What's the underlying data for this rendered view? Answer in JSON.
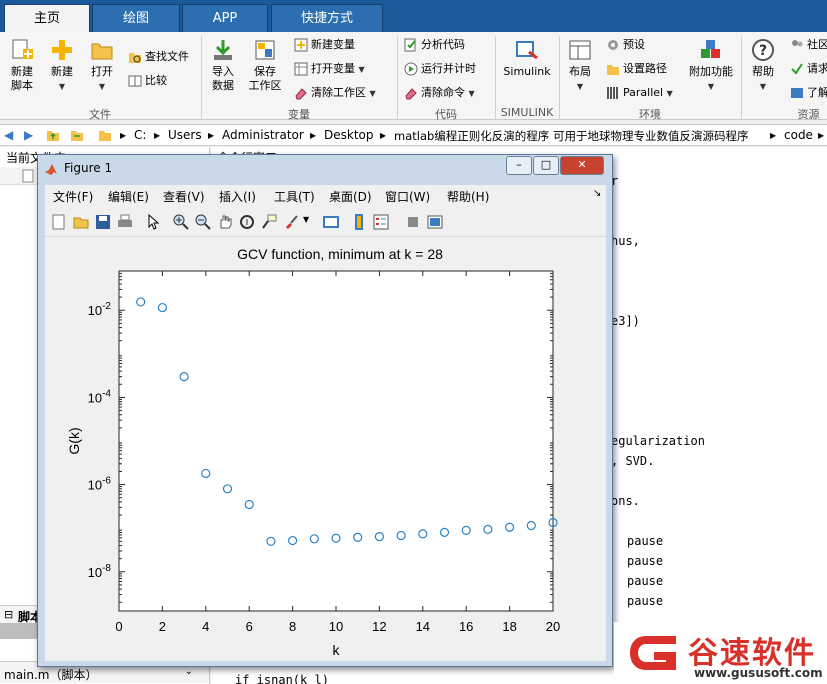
{
  "tabs": [
    "主页",
    "绘图",
    "APP",
    "快捷方式"
  ],
  "ribbon": {
    "file_group": {
      "label": "文件",
      "new_script": "新建\n脚本",
      "new": "新建",
      "open": "打开",
      "find_files": "查找文件",
      "compare": "比较"
    },
    "variable_group": {
      "label": "变量",
      "import_data": "导入\n数据",
      "save_workspace": "保存\n工作区",
      "new_variable": "新建变量",
      "open_variable": "打开变量",
      "clear_workspace": "清除工作区"
    },
    "code_group": {
      "label": "代码",
      "analyze_code": "分析代码",
      "run_and_time": "运行并计时",
      "clear_commands": "清除命令"
    },
    "simulink_group": {
      "label": "SIMULINK",
      "simulink": "Simulink"
    },
    "environment_group": {
      "label": "环境",
      "layout": "布局",
      "preferences": "预设",
      "set_path": "设置路径",
      "parallel": "Parallel",
      "addons": "附加功能"
    },
    "resources_group": {
      "label": "资源",
      "help": "帮助",
      "community": "社区",
      "request_support": "请求",
      "learn": "了解"
    }
  },
  "address": {
    "path": [
      "C:",
      "Users",
      "Administrator",
      "Desktop",
      "matlab编程正则化反演的程序 可用于地球物理专业数值反演源码程序",
      "code"
    ]
  },
  "left_panel": {
    "title": "当前文件夹",
    "details_label": "脚本",
    "bottom_file": "main.m（脚本）"
  },
  "right_panel": {
    "title": "命令行窗口",
    "lines": [
      {
        "text": "r",
        "row": 0
      },
      {
        "text": "hus,",
        "row": 1
      },
      {
        "text": "e3])",
        "row": 2
      },
      {
        "text": "egularization",
        "row": 3
      },
      {
        "text": ", SVD.",
        "row": 4
      },
      {
        "text": "ons.",
        "row": 5
      },
      {
        "text": "pause",
        "row": 6
      },
      {
        "text": "pause",
        "row": 7
      },
      {
        "text": "pause",
        "row": 8
      },
      {
        "text": "pause",
        "row": 9
      },
      {
        "text": "if isnan(k_l)",
        "row": 10
      }
    ]
  },
  "figure": {
    "title": "Figure 1",
    "menu": [
      "文件(F)",
      "编辑(E)",
      "查看(V)",
      "插入(I)",
      "工具(T)",
      "桌面(D)",
      "窗口(W)",
      "帮助(H)"
    ],
    "window_buttons": [
      "–",
      "□",
      "✕"
    ]
  },
  "chart_data": {
    "type": "scatter",
    "title": "GCV function, minimum at k = 28",
    "xlabel": "k",
    "ylabel": "G(k)",
    "xlim": [
      0,
      20
    ],
    "ylim_log10": [
      -8.9,
      -1.1
    ],
    "yscale": "log",
    "xticks": [
      0,
      2,
      4,
      6,
      8,
      10,
      12,
      14,
      16,
      18,
      20
    ],
    "yticks": [
      {
        "base": "10",
        "exp": "-2"
      },
      {
        "base": "10",
        "exp": "-4"
      },
      {
        "base": "10",
        "exp": "-6"
      },
      {
        "base": "10",
        "exp": "-8"
      }
    ],
    "ytick_values_log10": [
      -2,
      -4,
      -6,
      -8
    ],
    "marker": "circle",
    "color": "#2b82c3",
    "x": [
      1,
      2,
      3,
      4,
      5,
      6,
      7,
      8,
      9,
      10,
      11,
      12,
      13,
      14,
      15,
      16,
      17,
      18,
      19,
      20
    ],
    "y": [
      0.0155,
      0.0115,
      0.0003,
      1.8e-06,
      8e-07,
      3.5e-07,
      5e-08,
      5.2e-08,
      5.7e-08,
      5.9e-08,
      6.2e-08,
      6.4e-08,
      6.8e-08,
      7.4e-08,
      8e-08,
      8.9e-08,
      9.4e-08,
      1.05e-07,
      1.15e-07,
      1.35e-07
    ]
  },
  "watermark": {
    "brand": "谷速软件",
    "url": "www.gususoft.com",
    "color": "#d9302a"
  }
}
